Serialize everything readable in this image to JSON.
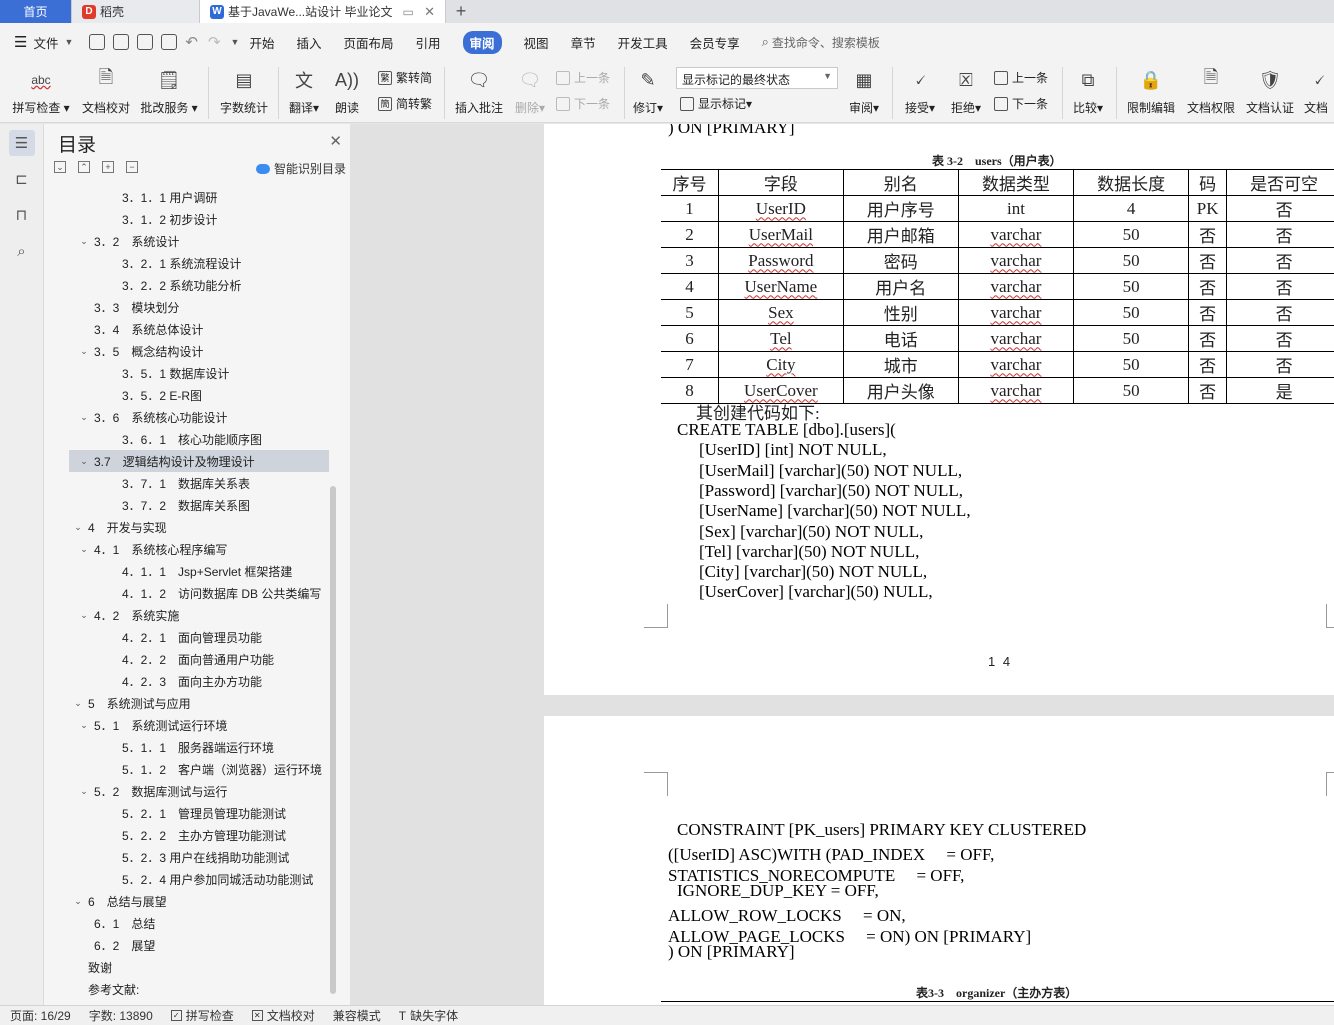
{
  "tabs": [
    {
      "label": "首页"
    },
    {
      "label": "稻壳"
    },
    {
      "label": "基于JavaWe...站设计 毕业论文"
    }
  ],
  "menu": {
    "file": "文件",
    "items": [
      "开始",
      "插入",
      "页面布局",
      "引用",
      "审阅",
      "视图",
      "章节",
      "开发工具",
      "会员专享"
    ],
    "active": "审阅",
    "search": "查找命令、搜索模板"
  },
  "ribbon": {
    "spell": "拼写检查",
    "doc_check": "文档校对",
    "batch": "批改服务",
    "word_count": "字数统计",
    "translate": "翻译",
    "read": "朗读",
    "trad": "繁转简",
    "simp": "简转繁",
    "insert_comment": "插入批注",
    "delete": "删除",
    "prev": "上一条",
    "next": "下一条",
    "revise": "修订",
    "show_mark": "显示标记",
    "final_state": "显示标记的最终状态",
    "review": "审阅",
    "accept": "接受",
    "reject": "拒绝",
    "prev2": "上一条",
    "next2": "下一条",
    "compare": "比较",
    "restrict": "限制编辑",
    "permission": "文档权限",
    "cert": "文档认证",
    "doc_cut": "文档"
  },
  "toc": {
    "title": "目录",
    "smart": "智能识别目录",
    "items": [
      {
        "text": "3．1．1 用户调研",
        "level": 3,
        "chev": false
      },
      {
        "text": "3．1．2 初步设计",
        "level": 3,
        "chev": false
      },
      {
        "text": "3．2　系统设计",
        "level": 2,
        "chev": true
      },
      {
        "text": "3．2．1 系统流程设计",
        "level": 3,
        "chev": false
      },
      {
        "text": "3．2．2 系统功能分析",
        "level": 3,
        "chev": false
      },
      {
        "text": "3．3　模块划分",
        "level": 2,
        "chev": false
      },
      {
        "text": "3．4　系统总体设计",
        "level": 2,
        "chev": false
      },
      {
        "text": "3．5　概念结构设计",
        "level": 2,
        "chev": true
      },
      {
        "text": "3．5．1 数据库设计",
        "level": 3,
        "chev": false
      },
      {
        "text": "3．5．2 E-R图",
        "level": 3,
        "chev": false
      },
      {
        "text": "3．6　系统核心功能设计",
        "level": 2,
        "chev": true
      },
      {
        "text": "3．6．1　核心功能顺序图",
        "level": 3,
        "chev": false
      },
      {
        "text": "3.7　逻辑结构设计及物理设计",
        "level": 2,
        "chev": true,
        "selected": true
      },
      {
        "text": "3．7．1　数据库关系表",
        "level": 3,
        "chev": false
      },
      {
        "text": "3．7．2　数据库关系图",
        "level": 3,
        "chev": false
      },
      {
        "text": "4　开发与实现",
        "level": 1,
        "chev": true
      },
      {
        "text": "4．1　系统核心程序编写",
        "level": 2,
        "chev": true
      },
      {
        "text": "4．1．1　Jsp+Servlet 框架搭建",
        "level": 3,
        "chev": false
      },
      {
        "text": "4．1．2　访问数据库 DB 公共类编写",
        "level": 3,
        "chev": false
      },
      {
        "text": "4．2　系统实施",
        "level": 2,
        "chev": true
      },
      {
        "text": "4．2．1　面向管理员功能",
        "level": 3,
        "chev": false
      },
      {
        "text": "4．2．2　面向普通用户功能",
        "level": 3,
        "chev": false
      },
      {
        "text": "4．2．3　面向主办方功能",
        "level": 3,
        "chev": false
      },
      {
        "text": "5　系统测试与应用",
        "level": 1,
        "chev": true
      },
      {
        "text": "5．1　系统测试运行环境",
        "level": 2,
        "chev": true
      },
      {
        "text": "5．1．1　服务器端运行环境",
        "level": 3,
        "chev": false
      },
      {
        "text": "5．1．2　客户端（浏览器）运行环境",
        "level": 3,
        "chev": false
      },
      {
        "text": "5．2　数据库测试与运行",
        "level": 2,
        "chev": true
      },
      {
        "text": "5．2．1　管理员管理功能测试",
        "level": 3,
        "chev": false
      },
      {
        "text": "5．2．2　主办方管理功能测试",
        "level": 3,
        "chev": false
      },
      {
        "text": "5．2．3 用户在线捐助功能测试",
        "level": 3,
        "chev": false
      },
      {
        "text": "5．2．4 用户参加同城活动功能测试",
        "level": 3,
        "chev": false
      },
      {
        "text": "6　总结与展望",
        "level": 1,
        "chev": true
      },
      {
        "text": "6．1　总结",
        "level": 2,
        "chev": false
      },
      {
        "text": "6．2　展望",
        "level": 2,
        "chev": false
      },
      {
        "text": "致谢",
        "level": 1,
        "chev": false
      },
      {
        "text": "参考文献:",
        "level": 1,
        "chev": false
      }
    ]
  },
  "doc": {
    "top_line": ") ON [PRIMARY]",
    "table_caption": "表 3-2　users（用户表）",
    "table_headers": [
      "序号",
      "字段",
      "别名",
      "数据类型",
      "数据长度",
      "码",
      "是否可空"
    ],
    "table_rows": [
      [
        "1",
        "UserID",
        "用户序号",
        "int",
        "4",
        "PK",
        "否"
      ],
      [
        "2",
        "UserMail",
        "用户邮箱",
        "varchar",
        "50",
        "否",
        "否"
      ],
      [
        "3",
        "Password",
        "密码",
        "varchar",
        "50",
        "否",
        "否"
      ],
      [
        "4",
        "UserName",
        "用户名",
        "varchar",
        "50",
        "否",
        "否"
      ],
      [
        "5",
        "Sex",
        "性别",
        "varchar",
        "50",
        "否",
        "否"
      ],
      [
        "6",
        "Tel",
        "电话",
        "varchar",
        "50",
        "否",
        "否"
      ],
      [
        "7",
        "City",
        "城市",
        "varchar",
        "50",
        "否",
        "否"
      ],
      [
        "8",
        "UserCover",
        "用户头像",
        "varchar",
        "50",
        "否",
        "是"
      ]
    ],
    "intro": "其创建代码如下:",
    "code": [
      "CREATE TABLE [dbo].[users](",
      "[UserID] [int] NOT NULL,",
      "[UserMail] [varchar](50) NOT NULL,",
      "[Password] [varchar](50) NOT NULL,",
      "[UserName] [varchar](50) NOT NULL,",
      "[Sex] [varchar](50) NOT NULL,",
      "[Tel] [varchar](50) NOT NULL,",
      "[City] [varchar](50) NOT NULL,",
      "[UserCover] [varchar](50) NULL,"
    ],
    "page_number": "1 4",
    "code2": [
      "CONSTRAINT [PK_users] PRIMARY KEY CLUSTERED",
      "([UserID] ASC)WITH (PAD_INDEX　 = OFF,",
      "STATISTICS_NORECOMPUTE　 = OFF,",
      "IGNORE_DUP_KEY = OFF,",
      "ALLOW_ROW_LOCKS　 = ON,",
      "ALLOW_PAGE_LOCKS　 = ON) ON [PRIMARY]",
      ") ON [PRIMARY]"
    ],
    "table2_caption": "表3-3　organizer（主办方表）"
  },
  "status": {
    "page": "页面: 16/29",
    "words": "字数: 13890",
    "spell": "拼写检查",
    "check": "文档校对",
    "compat": "兼容模式",
    "missing_font": "缺失字体"
  },
  "colors": {
    "accent": "#3b6fd6",
    "squiggle": "#d03030"
  }
}
